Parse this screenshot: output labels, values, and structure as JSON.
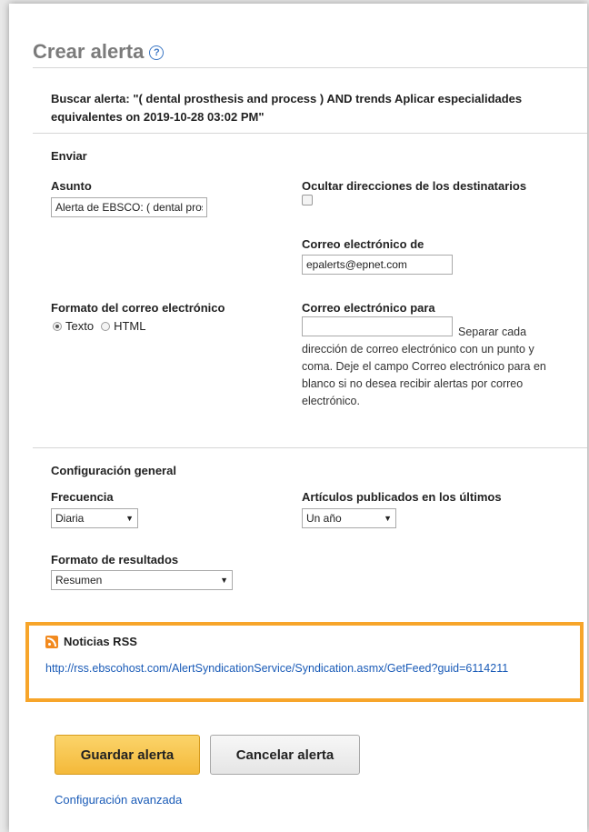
{
  "header": {
    "title": "Crear alerta",
    "help_icon": "?"
  },
  "search": {
    "text": "Buscar alerta: \"( dental prosthesis and process ) AND trends Aplicar especialidades equivalentes on 2019-10-28 03:02 PM\""
  },
  "send": {
    "section_title": "Enviar",
    "subject_label": "Asunto",
    "subject_value": "Alerta de EBSCO: ( dental prosthesis and process ) AND trends",
    "hide_label": "Ocultar direcciones de los destinatarios",
    "from_label": "Correo electrónico de",
    "from_value": "epalerts@epnet.com",
    "format_label": "Formato del correo electrónico",
    "format_text": "Texto",
    "format_html": "HTML",
    "to_label": "Correo electrónico para",
    "to_value": "",
    "to_help_first": "Separar cada",
    "to_help_rest": "dirección de correo electrónico con un punto y coma. Deje el campo Correo electrónico para en blanco si no desea recibir alertas por correo electrónico."
  },
  "general": {
    "section_title": "Configuración general",
    "frequency_label": "Frecuencia",
    "frequency_value": "Diaria",
    "published_label": "Artículos publicados en los últimos",
    "published_value": "Un año",
    "results_label": "Formato de resultados",
    "results_value": "Resumen"
  },
  "rss": {
    "title": "Noticias RSS",
    "link": "http://rss.ebscohost.com/AlertSyndicationService/Syndication.asmx/GetFeed?guid=6114211"
  },
  "actions": {
    "save_label": "Guardar alerta",
    "cancel_label": "Cancelar alerta",
    "advanced_label": "Configuración avanzada"
  },
  "colors": {
    "rss_border": "#f7a52a",
    "link": "#1a5bb7",
    "primary_button": "#f4b93a"
  }
}
